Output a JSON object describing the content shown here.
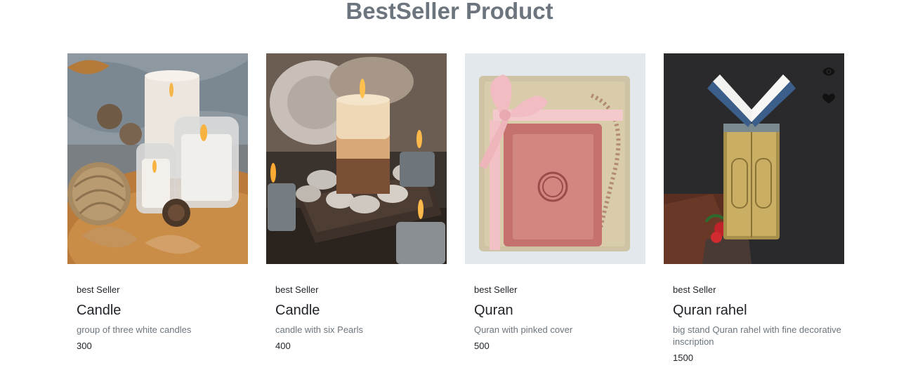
{
  "section": {
    "title": "BestSeller Product"
  },
  "products": [
    {
      "tag": "best Seller",
      "name": "Candle",
      "description": "group of three white candles",
      "price": "300",
      "image": "three-white-candles-photo"
    },
    {
      "tag": "best Seller",
      "name": "Candle",
      "description": "candle with six Pearls",
      "price": "400",
      "image": "candle-with-pearls-photo"
    },
    {
      "tag": "best Seller",
      "name": "Quran",
      "description": "Quran with pinked cover",
      "price": "500",
      "image": "pink-quran-gift-box-photo"
    },
    {
      "tag": "best Seller",
      "name": "Quran rahel",
      "description": "big stand Quran rahel with fine decorative inscription",
      "price": "1500",
      "image": "quran-on-golden-stand-photo"
    }
  ],
  "hover_actions": {
    "icons": [
      "eye-icon",
      "heart-icon"
    ]
  }
}
